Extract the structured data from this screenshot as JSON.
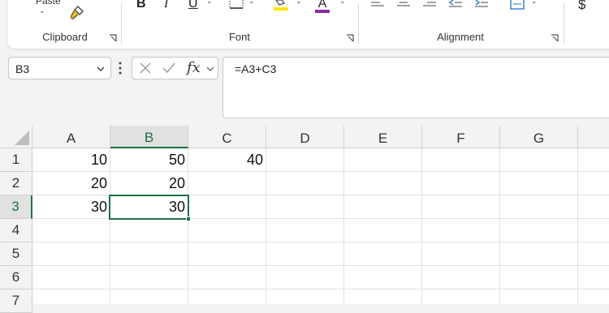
{
  "ribbon": {
    "paste_label": "Paste",
    "groups": [
      {
        "label": "Clipboard"
      },
      {
        "label": "Font"
      },
      {
        "label": "Alignment"
      }
    ],
    "font_buttons": {
      "bold": "B",
      "italic": "I",
      "underline": "U",
      "font_color_glyph": "A"
    },
    "number_symbol": "$",
    "colors": {
      "highlight": "#ffe500",
      "font_color": "#8e2aa0",
      "accent": "#1e7145"
    }
  },
  "formula_bar": {
    "name_box": "B3",
    "fx_label": "fx",
    "formula": "=A3+C3"
  },
  "sheet": {
    "columns": [
      "A",
      "B",
      "C",
      "D",
      "E",
      "F",
      "G"
    ],
    "active_column": "B",
    "rows": [
      "1",
      "2",
      "3",
      "4",
      "5",
      "6",
      "7"
    ],
    "active_row": "3",
    "cells": {
      "A1": "10",
      "B1": "50",
      "C1": "40",
      "A2": "20",
      "B2": "20",
      "A3": "30",
      "B3": "30"
    },
    "selected_cell": "B3"
  }
}
